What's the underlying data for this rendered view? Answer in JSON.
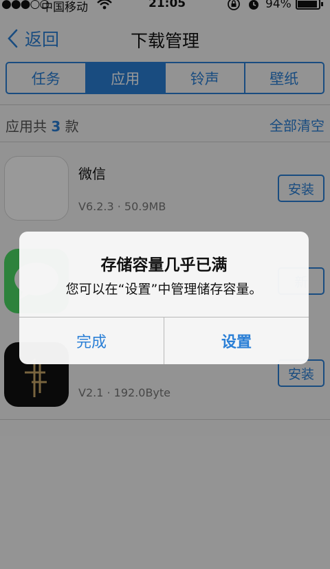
{
  "status_bar": {
    "signal": "●●●○○",
    "carrier": "中国移动",
    "time": "21:05",
    "battery_pct": "94%",
    "battery_level": 0.94
  },
  "nav": {
    "back_label": "返回",
    "title": "下载管理"
  },
  "tabs": [
    {
      "label": "任务",
      "active": false
    },
    {
      "label": "应用",
      "active": true
    },
    {
      "label": "铃声",
      "active": false
    },
    {
      "label": "壁纸",
      "active": false
    }
  ],
  "summary": {
    "prefix": "应用共",
    "count": "3",
    "suffix": "款",
    "clear_all": "全部清空"
  },
  "apps": [
    {
      "name": "微信",
      "meta": "V6.2.3 · 50.9MB",
      "action": "安装",
      "icon": "blank-app-icon"
    },
    {
      "name": "",
      "meta": "",
      "action": "新",
      "icon": "messages-app-icon"
    },
    {
      "name": "",
      "meta": "V2.1 · 192.0Byte",
      "action": "安装",
      "icon": "dark-app-icon"
    }
  ],
  "alert": {
    "title": "存储容量几乎已满",
    "message": "您可以在“设置”中管理储存容量。",
    "done": "完成",
    "settings": "设置"
  },
  "colors": {
    "accent": "#2a7fd6",
    "overlay": "rgba(0,0,0,0.40)"
  }
}
